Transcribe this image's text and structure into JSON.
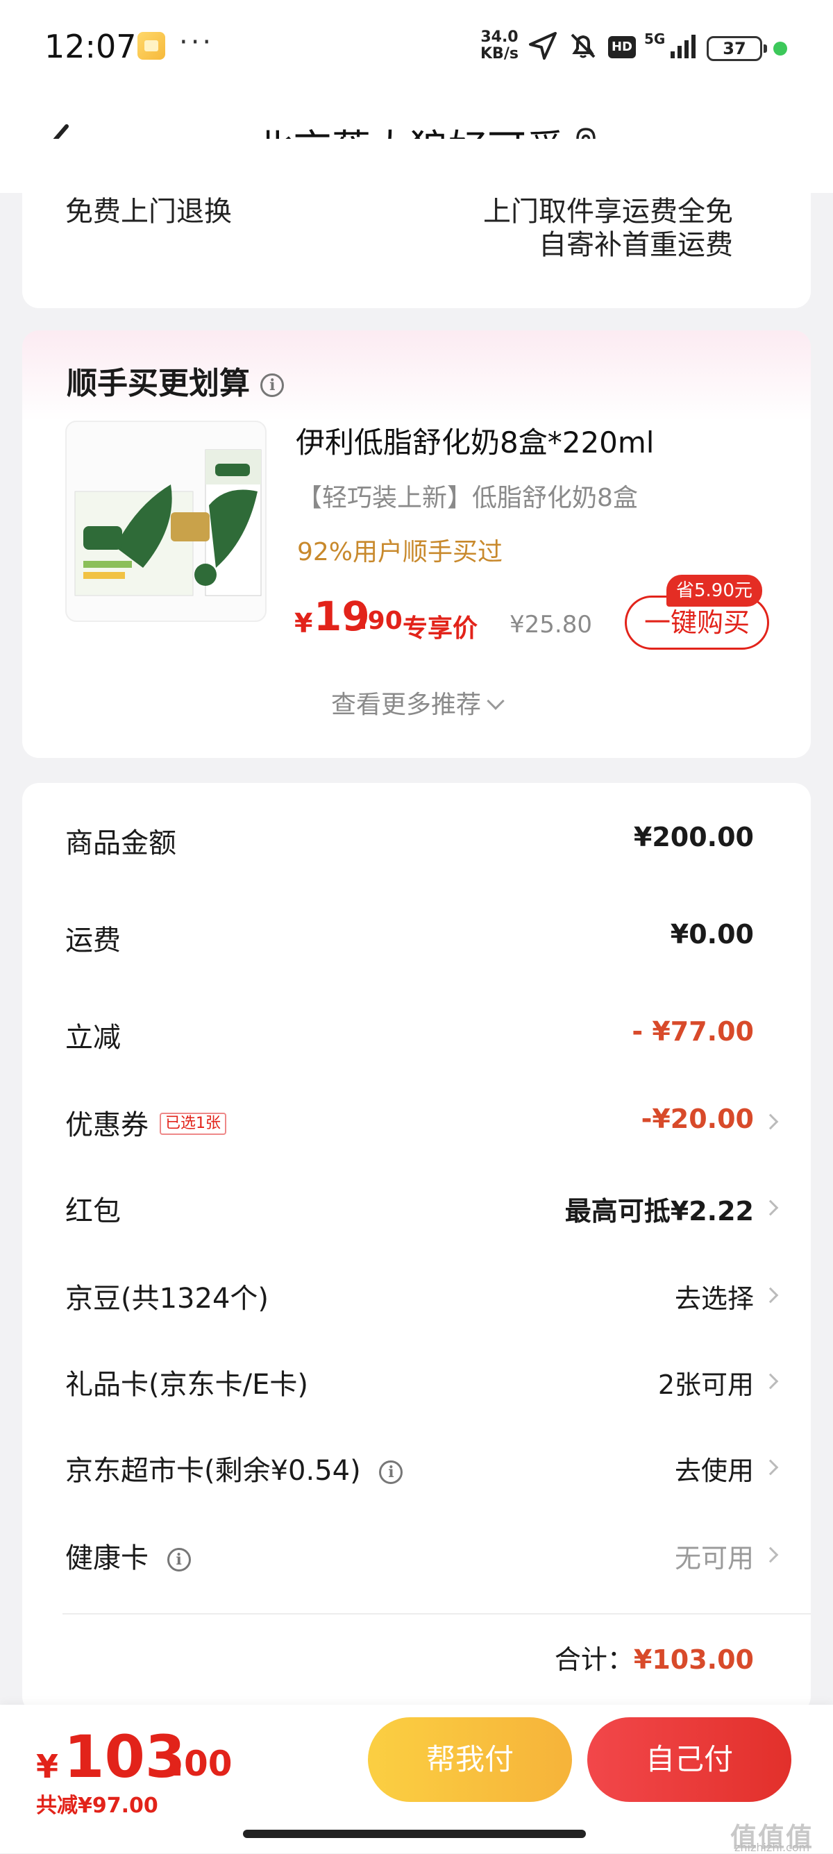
{
  "status": {
    "time": "12:07",
    "speed_value": "34.0",
    "speed_unit": "KB/s",
    "hd": "HD",
    "network": "5G",
    "battery": "37"
  },
  "header": {
    "title": "北京蕉太狼好可爱"
  },
  "return_card": {
    "label_clipped": "免费上门退换",
    "value_clipped": "上门取件享运费全免",
    "value_line2": "自寄补首重运费"
  },
  "recommend": {
    "title": "顺手买更划算",
    "product": {
      "name": "伊利低脂舒化奶8盒*220ml",
      "subtitle": "【轻巧装上新】低脂舒化奶8盒",
      "hint": "92%用户顺手买过",
      "price_currency": "¥",
      "price_int": "19",
      "price_dec": ".90",
      "price_tag": "专享价",
      "original_price": "¥25.80",
      "save_badge": "省5.90元",
      "buy_label": "一键购买"
    },
    "more_label": "查看更多推荐"
  },
  "summary": {
    "rows": [
      {
        "label": "商品金额",
        "value": "¥200.00"
      },
      {
        "label": "运费",
        "value": "¥0.00"
      },
      {
        "label": "立减",
        "value": "- ¥77.00"
      },
      {
        "label": "优惠券",
        "badge": "已选1张",
        "value": "-¥20.00"
      },
      {
        "label": "红包",
        "value": "最高可抵¥2.22"
      },
      {
        "label": "京豆(共1324个)",
        "value": "去选择"
      },
      {
        "label": "礼品卡(京东卡/E卡)",
        "value": "2张可用"
      },
      {
        "label": "京东超市卡(剩余¥0.54)",
        "value": "去使用"
      },
      {
        "label": "健康卡",
        "value": "无可用"
      }
    ],
    "total_label": "合计：",
    "total_value": "¥103.00"
  },
  "bottom": {
    "currency": "¥",
    "amount_int": "103",
    "amount_dec": ".00",
    "saved": "共减¥97.00",
    "help_pay_label": "帮我付",
    "self_pay_label": "自己付"
  },
  "watermark": {
    "text": "值值值",
    "domain": "zhizhizhi.com"
  },
  "colors": {
    "accent_red": "#e2231a",
    "discount_red": "#d84a2a",
    "gold": "#c8892c",
    "help_yellow": "#f6b33a"
  }
}
